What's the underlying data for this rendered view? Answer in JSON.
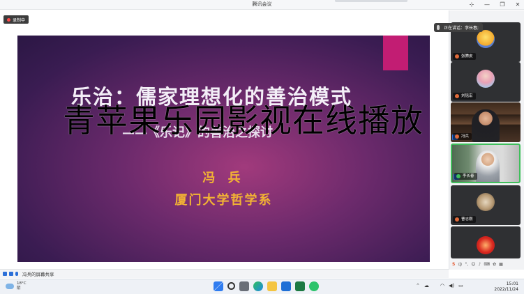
{
  "window": {
    "title": "腾讯会议"
  },
  "recording": {
    "label": "录制中"
  },
  "slide": {
    "title": "乐治：儒家理想化的善治模式",
    "subtitle": "——《乐记》的善治之探讨",
    "author": "冯 兵",
    "institution": "厦门大学哲学系",
    "accent_color": "#c21d73",
    "text_color": "#f2b234"
  },
  "overlay_text": "青苹果乐园影视在线播放",
  "speaking": {
    "label": "正在讲话：李长春;"
  },
  "participants": [
    {
      "name": "张腾皮",
      "type": "avatar"
    },
    {
      "name": "刘铭宏",
      "type": "avatar"
    },
    {
      "name": "冯兵",
      "type": "video"
    },
    {
      "name": "李长春",
      "type": "video",
      "active": true
    },
    {
      "name": "曹志刚",
      "type": "avatar"
    },
    {
      "name": "",
      "type": "avatar"
    }
  ],
  "share_bar": {
    "label": "冯兵的屏幕共享"
  },
  "taskbar": {
    "weather_temp": "18°C",
    "weather_desc": "阴",
    "time": "15:01",
    "date": "2022/11/24"
  }
}
